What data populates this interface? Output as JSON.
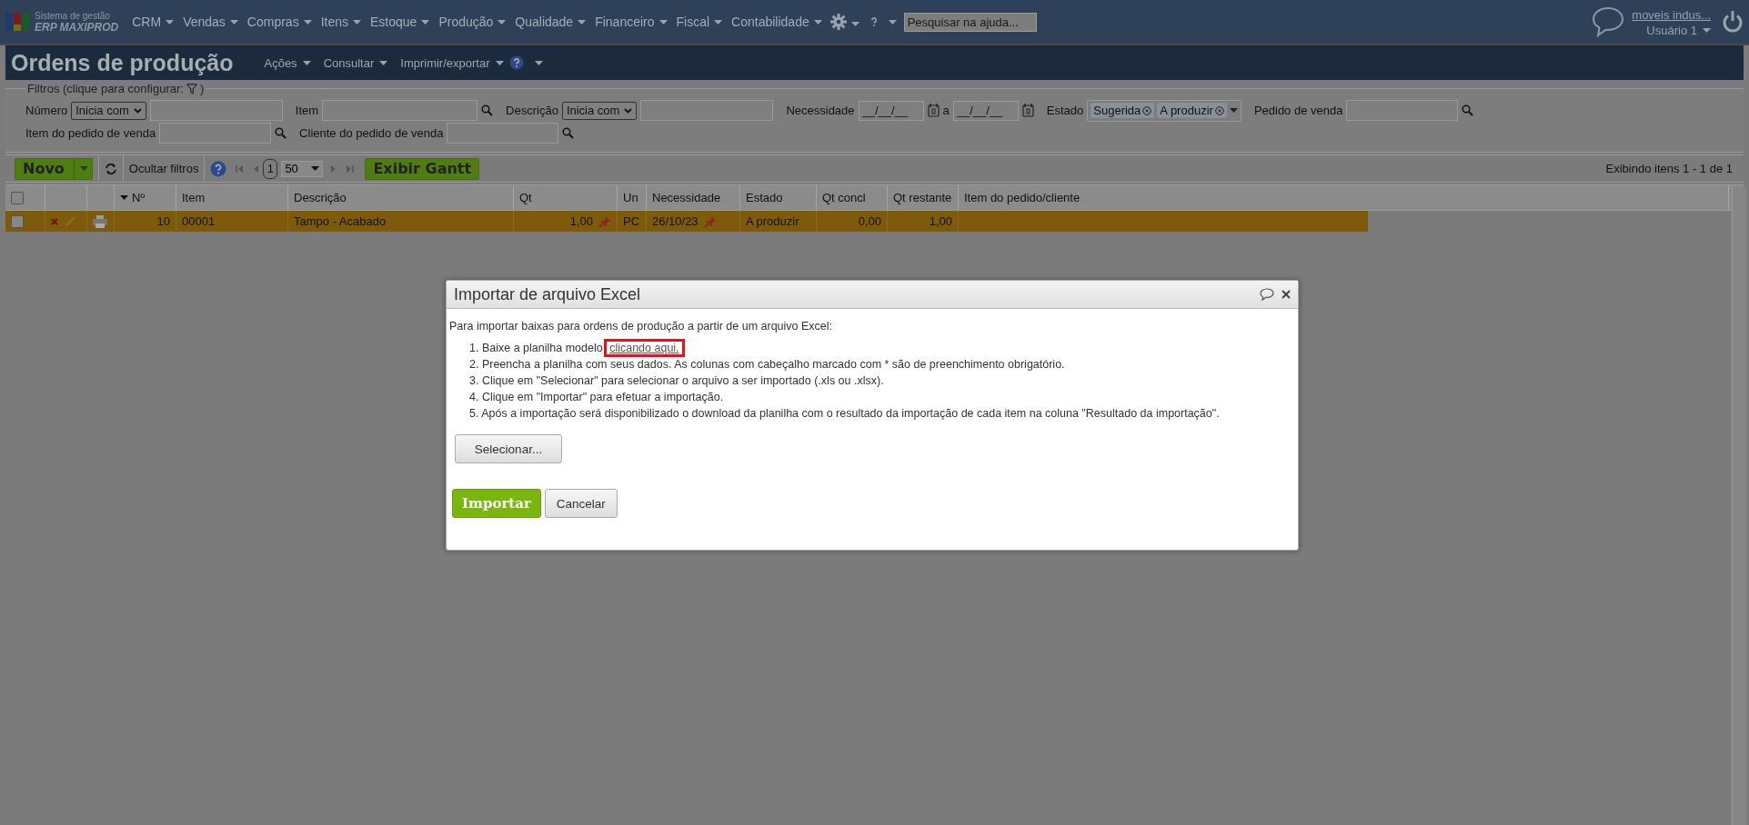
{
  "top_bar": {
    "logo": {
      "line1": "Sistema de gestão",
      "line2": "ERP MAXIPROD"
    },
    "menu": [
      {
        "label": "CRM"
      },
      {
        "label": "Vendas"
      },
      {
        "label": "Compras"
      },
      {
        "label": "Itens"
      },
      {
        "label": "Estoque"
      },
      {
        "label": "Produção"
      },
      {
        "label": "Qualidade"
      },
      {
        "label": "Financeiro"
      },
      {
        "label": "Fiscal"
      },
      {
        "label": "Contabilidade"
      }
    ],
    "help_search": {
      "placeholder": "Pesquisar na ajuda..."
    },
    "user": {
      "company": "moveis indus...",
      "name": "Usuário 1"
    }
  },
  "page_header": {
    "title": "Ordens de produção",
    "actions": [
      "Ações",
      "Consultar",
      "Imprimir/exportar"
    ]
  },
  "filters": {
    "legend": "Filtros (clique para configurar:",
    "legend_end": ")",
    "rows": [
      [
        {
          "kind": "select_text",
          "label": "Número",
          "option": "Inicia com"
        },
        {
          "kind": "lookup",
          "label": "Item"
        },
        {
          "kind": "select_text",
          "label": "Descrição",
          "option": "Inicia com"
        },
        {
          "kind": "date_range",
          "label": "Necessidade",
          "from": "__/__/__",
          "separator": "a",
          "to": "__/__/__"
        },
        {
          "kind": "tags",
          "label": "Estado",
          "tags": [
            "Sugerida",
            "A produzir"
          ]
        },
        {
          "kind": "lookup",
          "label": "Pedido de venda"
        }
      ],
      [
        {
          "kind": "lookup",
          "label": "Item do pedido de venda"
        },
        {
          "kind": "lookup",
          "label": "Cliente do pedido de venda"
        }
      ]
    ]
  },
  "toolbar": {
    "new_button": "Novo",
    "hide_filters": "Ocultar filtros",
    "page": "1",
    "page_size": "50",
    "gantt_button": "Exibir Gantt",
    "summary": "Exibindo itens 1 - 1 de 1"
  },
  "table": {
    "all_checked": false,
    "columns": [
      {
        "label": "Nº",
        "sorted": true
      },
      {
        "label": "Item",
        "sorted": false
      },
      {
        "label": "Descrição",
        "sorted": false
      },
      {
        "label": "Qt",
        "sorted": false
      },
      {
        "label": "Un",
        "sorted": false
      },
      {
        "label": "Necessidade",
        "sorted": false
      },
      {
        "label": "Estado",
        "sorted": false
      },
      {
        "label": "Qt concl",
        "sorted": false
      },
      {
        "label": "Qt restante",
        "sorted": false
      },
      {
        "label": "Item do pedido/cliente",
        "sorted": false
      }
    ],
    "rows": [
      {
        "selected": true,
        "checked": false,
        "cells": [
          "10",
          "00001",
          "Tampo - Acabado",
          "1,00",
          "PC",
          "26/10/23",
          "A produzir",
          "0,00",
          "1,00"
        ]
      }
    ]
  },
  "dialog": {
    "title": "Importar de arquivo Excel",
    "intro": "Para importar baixas para ordens de produção a partir de um arquivo Excel:",
    "steps": [
      {
        "number": "1.",
        "text": "Baixe a planilha modelo",
        "link": "clicando aqui."
      },
      {
        "number": "2.",
        "text": "Preencha a planilha com seus dados. As colunas com cabeçalho marcado com * são de preenchimento obrigatório."
      },
      {
        "number": "3.",
        "text": "Clique em \"Selecionar\" para selecionar o arquivo a ser importado (.xls ou .xlsx)."
      },
      {
        "number": "4.",
        "text": "Clique em \"Importar\" para efetuar a importação."
      },
      {
        "number": "5.",
        "text": "Após a importação será disponibilizado o download da planilha com o resultado da importação de cada item na coluna \"Resultado da importação\"."
      }
    ],
    "select_button": "Selecionar...",
    "import_button": "Importar",
    "cancel_button": "Cancelar"
  }
}
